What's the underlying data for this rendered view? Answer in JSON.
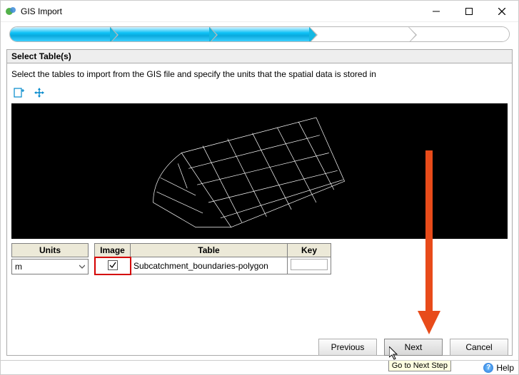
{
  "window": {
    "title": "GIS Import",
    "min_label": "Minimize",
    "max_label": "Maximize",
    "close_label": "Close"
  },
  "panel": {
    "title": "Select Table(s)",
    "instruction": "Select the tables to import from the GIS file and specify the units that the spatial data is stored in"
  },
  "toolbar": {
    "zoom_extent_icon": "zoom-extent",
    "pan_icon": "pan-move"
  },
  "units": {
    "label": "Units",
    "selected": "m"
  },
  "table": {
    "columns": {
      "image": "Image",
      "table": "Table",
      "key": "Key"
    },
    "rows": [
      {
        "image_checked": true,
        "table_name": "Subcatchment_boundaries-polygon",
        "key": ""
      }
    ]
  },
  "buttons": {
    "previous": "Previous",
    "next": "Next",
    "cancel": "Cancel"
  },
  "tooltip": {
    "next_step": "Go to Next Step"
  },
  "status": {
    "help": "Help"
  }
}
